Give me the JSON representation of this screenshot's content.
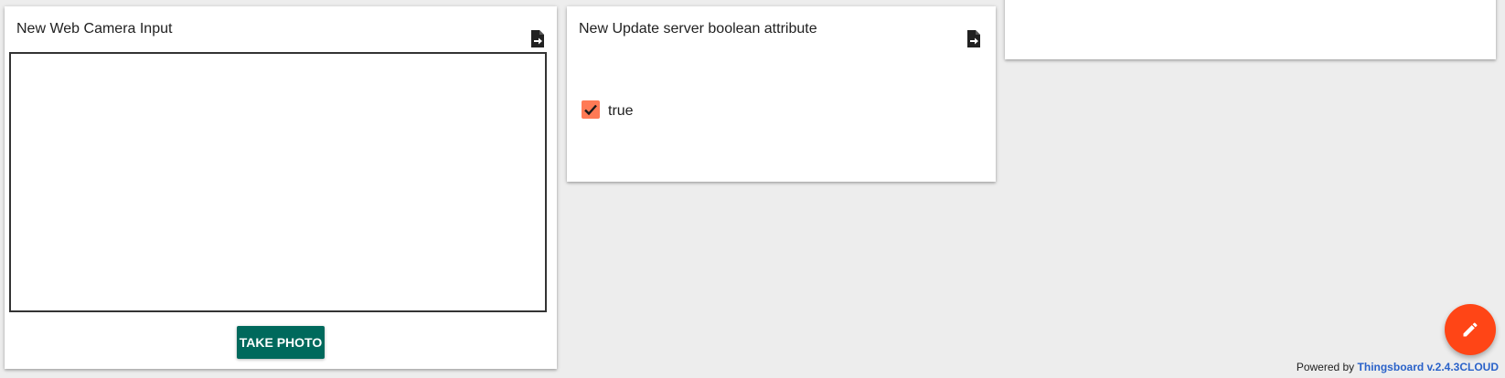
{
  "widgets": {
    "camera": {
      "title": "New Web Camera Input",
      "button_label": "TAKE PHOTO",
      "export_icon": "file-export-icon"
    },
    "boolean_attr": {
      "title": "New Update server boolean attribute",
      "checkbox_checked": true,
      "checkbox_label": "true",
      "export_icon": "file-export-icon"
    }
  },
  "fab": {
    "icon": "pencil-icon"
  },
  "footer": {
    "prefix": "Powered by",
    "link_text": "Thingsboard v.2.4.3CLOUD"
  },
  "colors": {
    "background": "#ededed",
    "button": "#00695c",
    "checkbox": "#ff7a55",
    "fab": "#ff4516",
    "link": "#2a62c9"
  }
}
